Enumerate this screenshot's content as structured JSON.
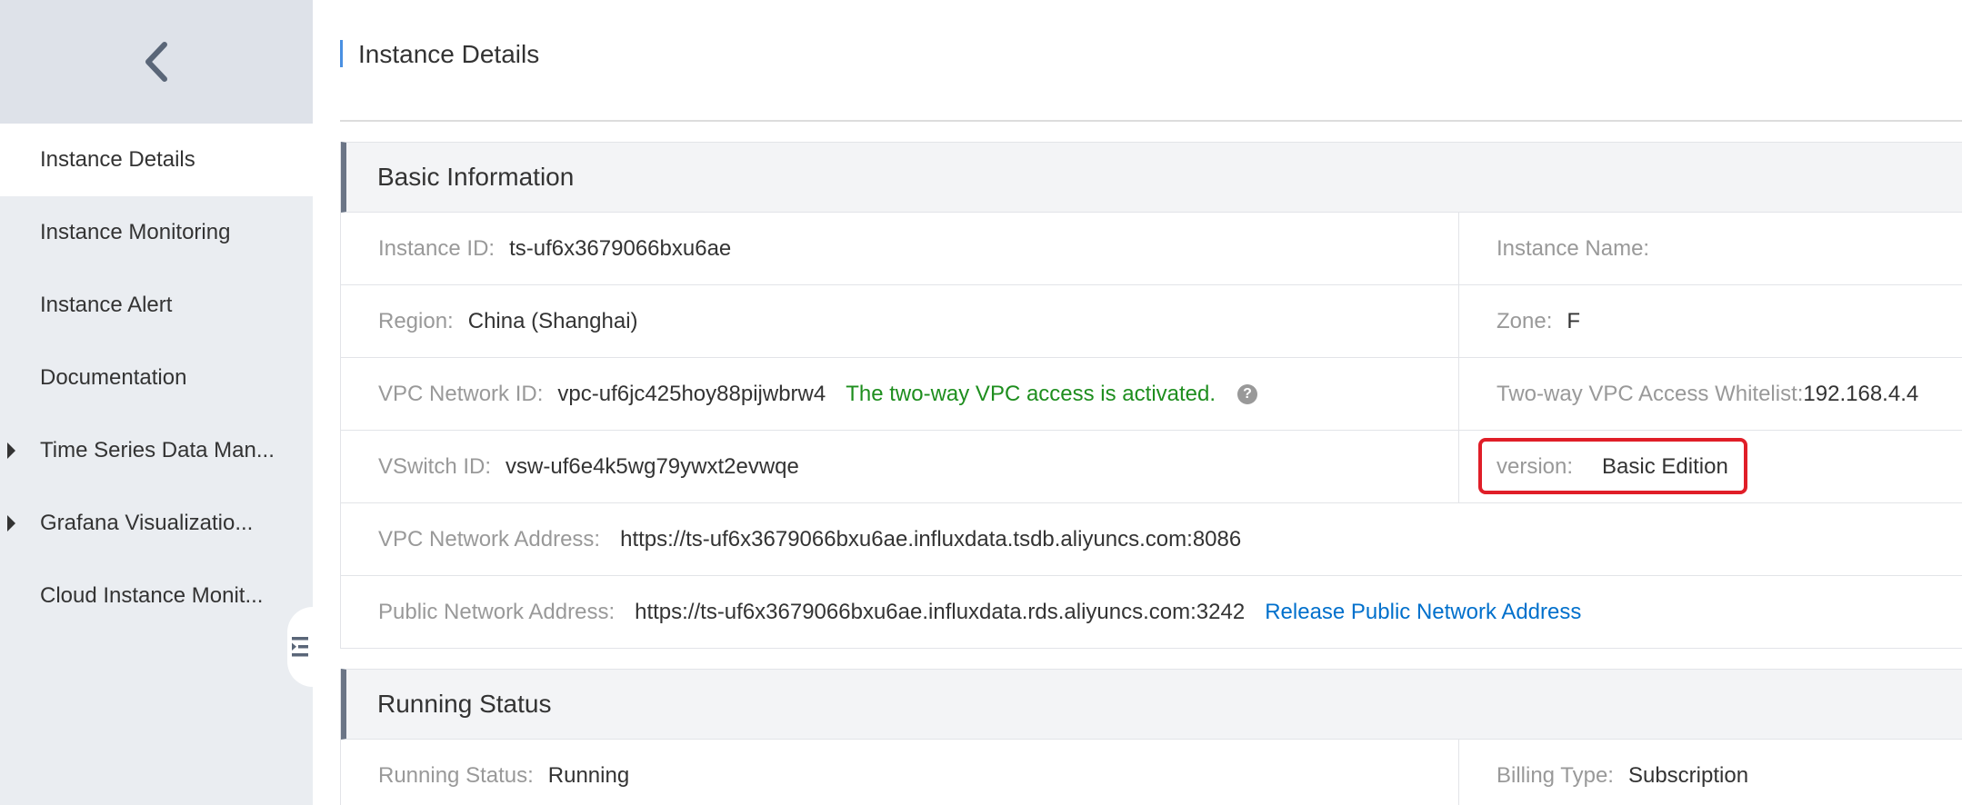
{
  "sidebar": {
    "back_icon": "chevron-left-icon",
    "collapse_icon": "collapse-sidebar-icon",
    "items": [
      {
        "label": "Instance Details",
        "active": true
      },
      {
        "label": "Instance Monitoring"
      },
      {
        "label": "Instance Alert"
      },
      {
        "label": "Documentation"
      },
      {
        "label": "Time Series Data Man...",
        "expandable": true
      },
      {
        "label": "Grafana Visualizatio...",
        "expandable": true
      },
      {
        "label": "Cloud Instance Monit..."
      }
    ]
  },
  "page": {
    "title": "Instance Details"
  },
  "basic_info": {
    "title": "Basic Information",
    "instance_id": {
      "label": "Instance ID:",
      "value": "ts-uf6x3679066bxu6ae"
    },
    "instance_name": {
      "label": "Instance Name:",
      "value": ""
    },
    "region": {
      "label": "Region:",
      "value": "China (Shanghai)"
    },
    "zone": {
      "label": "Zone:",
      "value": "F"
    },
    "vpc_network_id": {
      "label": "VPC Network ID:",
      "value": "vpc-uf6jc425hoy88pijwbrw4",
      "status": "The two-way VPC access is activated."
    },
    "vpc_whitelist": {
      "label": "Two-way VPC Access Whitelist:",
      "value": "192.168.4.4"
    },
    "vswitch_id": {
      "label": "VSwitch ID:",
      "value": "vsw-uf6e4k5wg79ywxt2evwqe"
    },
    "version": {
      "label": "version:",
      "value": "Basic Edition"
    },
    "vpc_address": {
      "label": "VPC Network Address:",
      "value": "https://ts-uf6x3679066bxu6ae.influxdata.tsdb.aliyuncs.com:8086"
    },
    "public_address": {
      "label": "Public Network Address:",
      "value": "https://ts-uf6x3679066bxu6ae.influxdata.rds.aliyuncs.com:3242",
      "action": "Release Public Network Address"
    }
  },
  "running_status": {
    "title": "Running Status",
    "status": {
      "label": "Running Status:",
      "value": "Running"
    },
    "billing": {
      "label": "Billing Type:",
      "value": "Subscription"
    }
  },
  "colors": {
    "accent": "#4a90e2",
    "success": "#1e8e1e",
    "link": "#0070cc",
    "highlight": "#e01e28"
  }
}
